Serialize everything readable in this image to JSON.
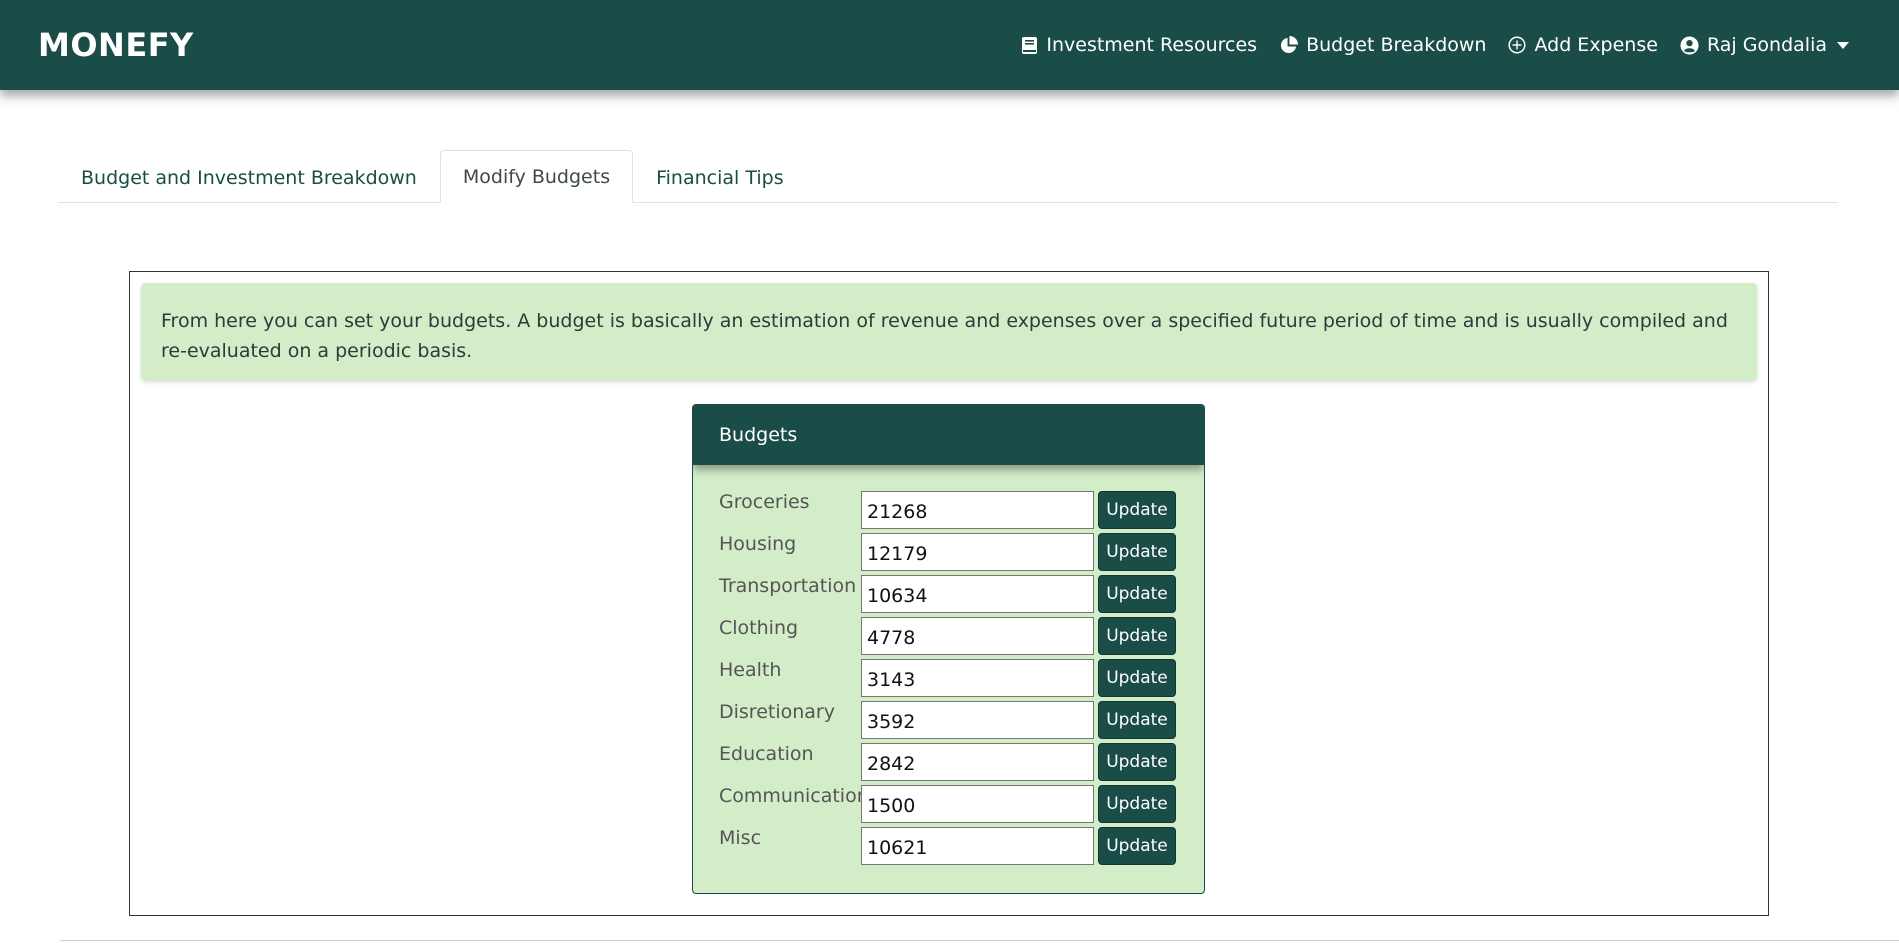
{
  "navbar": {
    "brand": "MONEFY",
    "links": [
      {
        "label": "Investment Resources",
        "icon": "book-icon"
      },
      {
        "label": "Budget Breakdown",
        "icon": "pie-chart-icon"
      },
      {
        "label": "Add Expense",
        "icon": "plus-circle-icon"
      },
      {
        "label": "Raj Gondalia",
        "icon": "user-circle-icon"
      }
    ]
  },
  "tabs": [
    {
      "label": "Budget and Investment Breakdown",
      "active": false
    },
    {
      "label": "Modify Budgets",
      "active": true
    },
    {
      "label": "Financial Tips",
      "active": false
    }
  ],
  "alert": {
    "text": "From here you can set your budgets. A budget is basically an estimation of revenue and expenses over a specified future period of time and is usually compiled and re-evaluated on a periodic basis."
  },
  "budgets": {
    "title": "Budgets",
    "button_label": "Update",
    "items": [
      {
        "label": "Groceries",
        "value": "21268"
      },
      {
        "label": "Housing",
        "value": "12179"
      },
      {
        "label": "Transportation",
        "value": "10634"
      },
      {
        "label": "Clothing",
        "value": "4778"
      },
      {
        "label": "Health",
        "value": "3143"
      },
      {
        "label": "Disretionary",
        "value": "3592"
      },
      {
        "label": "Education",
        "value": "2842"
      },
      {
        "label": "Communication",
        "value": "1500"
      },
      {
        "label": "Misc",
        "value": "10621"
      }
    ]
  },
  "colors": {
    "primary": "#1a4d47",
    "alert_bg": "#d4edc9"
  }
}
